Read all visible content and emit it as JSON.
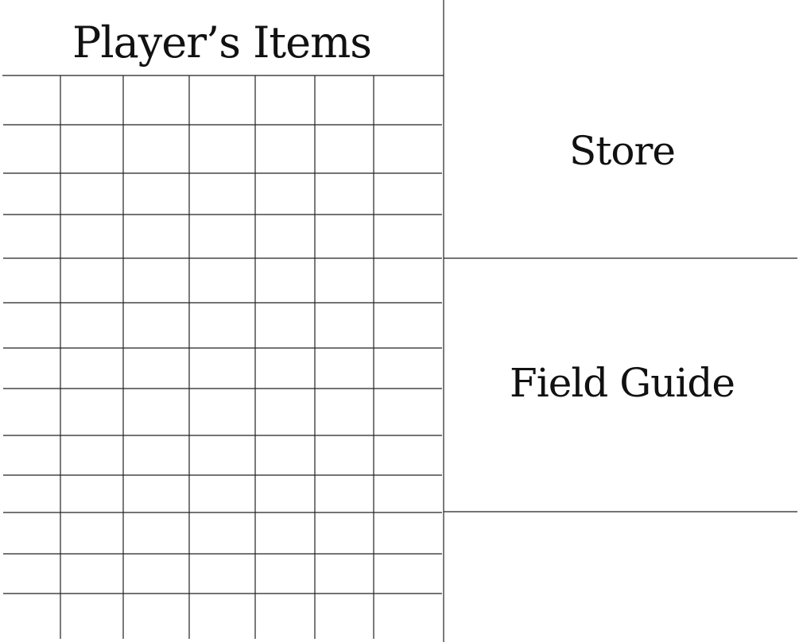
{
  "player_items": {
    "title": "Player’s Items",
    "columns": 7,
    "rows": 13
  },
  "store": {
    "title": "Store"
  },
  "field_guide": {
    "title": "Field Guide"
  },
  "colors": {
    "background": "#ffffff",
    "lines": "#222222",
    "text": "#111111"
  }
}
